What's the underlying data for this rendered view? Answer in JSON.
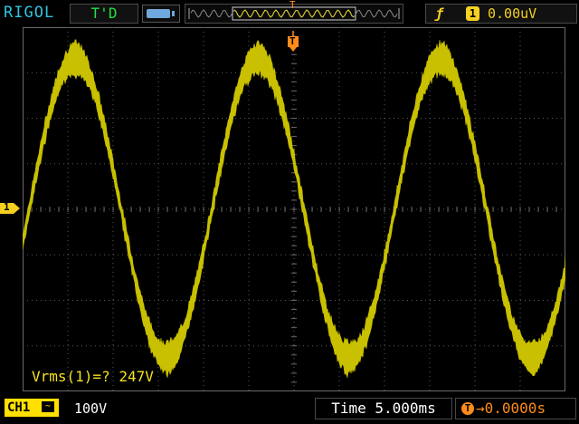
{
  "header": {
    "brand": "RIGOL",
    "run_status": "T'D",
    "trigger_edge_icon": "rising-edge-icon",
    "trigger_channel": "1",
    "trigger_level": "0.00uV",
    "memory_marker": "T"
  },
  "screen": {
    "trigger_marker": "T",
    "channel_marker": "1",
    "measurement": "Vrms(1)=? 247V"
  },
  "footer": {
    "channel_label": "CH1",
    "coupling_symbol": "~",
    "volts_per_div": "100V",
    "timebase": "Time 5.000ms",
    "trigger_offset": "0.0000s"
  },
  "colors": {
    "trace": "#c8c000",
    "channel": "#ffe000",
    "trigger": "#ff8c1a",
    "status": "#22e040",
    "brand": "#2ec4e0"
  }
}
